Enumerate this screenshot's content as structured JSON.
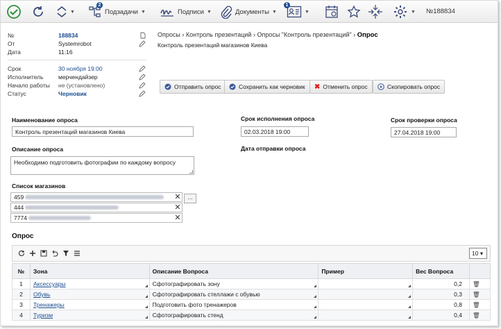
{
  "toolbar": {
    "subtasks": "Подзадачи",
    "signatures": "Подписи",
    "documents": "Документы",
    "subtasks_badge": "2",
    "notes_badge": "1",
    "doc_number": "№188834"
  },
  "info": {
    "number_label": "№",
    "number": "188834",
    "from_label": "От",
    "from": "Systemrobot",
    "date_label": "Дата",
    "date": "11:16",
    "deadline_label": "Срок",
    "deadline": "30 ноября 19:00",
    "executor_label": "Исполнитель",
    "executor": "мерчендайзер",
    "start_label": "Начало работы",
    "start": "не (установлено)",
    "status_label": "Статус",
    "status": "Черновик"
  },
  "breadcrumb": {
    "c1": "Опросы",
    "c2": "Контроль презентаций",
    "c3": "Опросы \"Контроль презентаций\"",
    "current": "Опрос",
    "sep": "›"
  },
  "subtitle": "Контроль презентаций магазинов Киева",
  "actions": {
    "send": "Отправить опрос",
    "save_draft": "Сохранить как черновик",
    "cancel": "Отменить опрос",
    "copy": "Скопировать опрос"
  },
  "form": {
    "name_label": "Наименование опроса",
    "name_value": "Контроль презентаций магазинов Киева",
    "desc_label": "Описание опроса",
    "desc_value": "Необходимо подготовить фотографии по каждому вопросу",
    "stores_label": "Список магазинов",
    "stores": [
      "459",
      "444",
      "7774"
    ],
    "more": "...",
    "deadline_label": "Срок исполнения опроса",
    "deadline_value": "02.03.2018 19:00",
    "check_label": "Срок проверки опроса",
    "check_value": "27.04.2018 19:00",
    "sent_label": "Дата отправки опроса"
  },
  "survey": {
    "title": "Опрос",
    "page_size": "10 ▾",
    "headers": [
      "№",
      "Зона",
      "Описание Вопроса",
      "Пример",
      "Вес Вопроса"
    ],
    "rows": [
      {
        "n": "1",
        "zone": "Аксессуары",
        "desc": "Сфотографировать зону",
        "example": "",
        "weight": "0,2"
      },
      {
        "n": "2",
        "zone": "Обувь",
        "desc": "Сфотографировать стеллажи с обувью",
        "example": "",
        "weight": "0,3"
      },
      {
        "n": "3",
        "zone": "Тренажеры",
        "desc": "Подготовить фото тренажеров",
        "example": "",
        "weight": "0,8"
      },
      {
        "n": "4",
        "zone": "Туризм",
        "desc": "Сфотографировать стенд",
        "example": "",
        "weight": "0,4"
      }
    ]
  }
}
